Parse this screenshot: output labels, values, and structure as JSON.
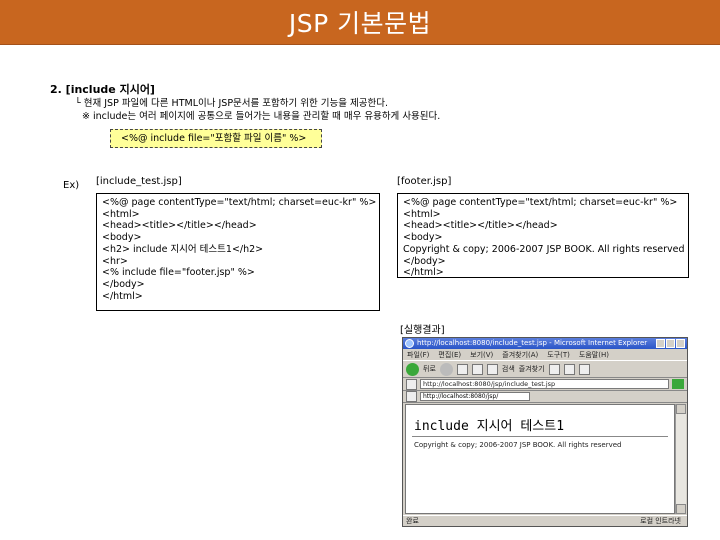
{
  "header": {
    "title": "JSP 기본문법",
    "color": "#c8661f"
  },
  "section": {
    "heading": "2. [include 지시어]",
    "line1": "└ 현재 JSP 파일에 다른 HTML이나 JSP문서를 포함하기 위한 기능을 제공한다.",
    "line2": "※ include는 여러 페이지에 공통으로 들어가는 내용을 관리할 때 매우 유용하게 사용된다.",
    "syntax": "<%@ include file=\"포함할 파일 이름\" %>"
  },
  "example": {
    "label": "Ex)",
    "file1": {
      "name": "[include_test.jsp]",
      "lines": [
        "<%@ page contentType=\"text/html; charset=euc-kr\" %>",
        "<html>",
        "<head><title></title></head>",
        "<body>",
        "<h2> include 지시어 테스트1</h2>",
        "<hr>",
        "<% include file=\"footer.jsp\" %>",
        "</body>",
        "</html>"
      ]
    },
    "file2": {
      "name": "[footer.jsp]",
      "lines": [
        "<%@ page contentType=\"text/html; charset=euc-kr\" %>",
        "<html>",
        "<head><title></title></head>",
        "<body>",
        "Copyright & copy; 2006-2007 JSP BOOK. All rights reserved",
        "</body>",
        "</html>"
      ]
    },
    "result_label": "[실행결과]"
  },
  "browser": {
    "window_title": "http://localhost:8080/include_test.jsp - Microsoft Internet Explorer",
    "menu": [
      "파일(F)",
      "편집(E)",
      "보기(V)",
      "즐겨찾기(A)",
      "도구(T)",
      "도움말(H)"
    ],
    "toolbar": {
      "back": "뒤로",
      "search": "검색",
      "favorites": "즐겨찾기"
    },
    "address": "http://localhost:8080/jsp/include_test.jsp",
    "links": "http://localhost:8080/jsp/",
    "page_heading": "include 지시어 테스트1",
    "page_footer": "Copyright & copy; 2006-2007 JSP BOOK. All rights reserved",
    "status_left": "완료",
    "status_right": "로컬 인트라넷"
  }
}
